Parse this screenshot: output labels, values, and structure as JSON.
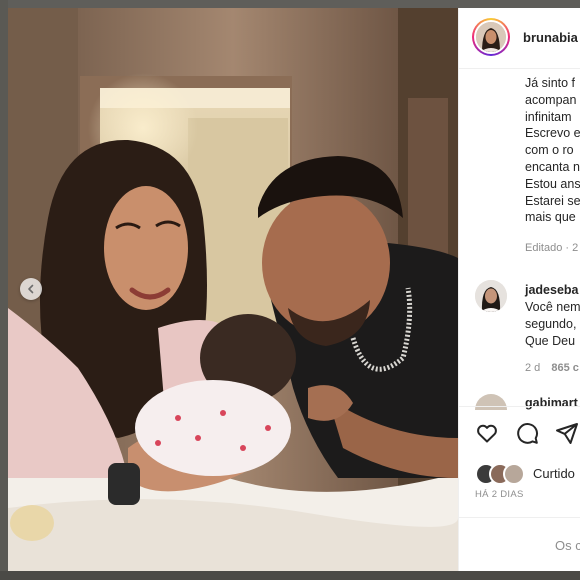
{
  "post": {
    "username": "brunabia",
    "caption_lines": [
      "Já sinto f",
      "acompan",
      "infinitam",
      "Escrevo e",
      "com o ro",
      "encanta n",
      "Estou ans",
      "Estarei se",
      "mais que"
    ],
    "caption_meta": "Editado · 2"
  },
  "comments": [
    {
      "username": "jadeseba",
      "lines": [
        "Você nem",
        "segundo,",
        "Que Deu"
      ],
      "time": "2 d",
      "likes": "865 c"
    },
    {
      "username": "gabimart"
    }
  ],
  "actions": {
    "like_icon": "heart-icon",
    "comment_icon": "comment-icon",
    "share_icon": "share-icon"
  },
  "likes": {
    "text": "Curtido",
    "date": "HÁ 2 DIAS"
  },
  "add_comment": {
    "placeholder": "Os c"
  },
  "colors": {
    "text": "#262626",
    "muted": "#8e8e8e",
    "divider": "#efefef"
  }
}
